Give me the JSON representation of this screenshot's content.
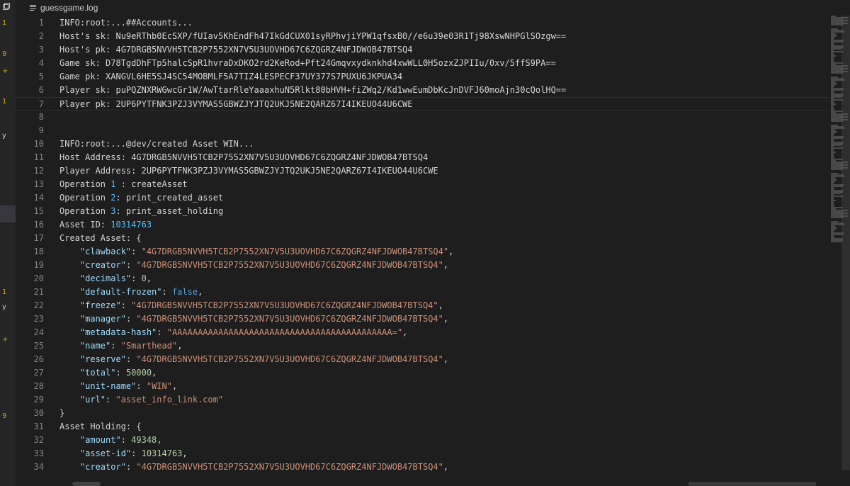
{
  "tab": {
    "filename": "guessgame.log"
  },
  "left_panel": {
    "marks": [
      {
        "text": "1"
      },
      {
        "text": "9"
      },
      {
        "text": "+"
      },
      {
        "text": "1"
      },
      {
        "text": "y"
      },
      {
        "text": "1"
      },
      {
        "text": "y"
      },
      {
        "text": "+"
      },
      {
        "text": "9"
      }
    ]
  },
  "lines": [
    {
      "num": "1",
      "text": "INFO:root:...##Accounts..."
    },
    {
      "num": "2",
      "text": "Host's sk: Nu9eRThb0EcSXP/fUIav5KhEndFh47IkGdCUX01syRPhvjiYPW1qfsxB0//e6u39e03R1Tj98XswNHPGlSOzgw=="
    },
    {
      "num": "3",
      "text": "Host's pk: 4G7DRGB5NVVH5TCB2P7552XN7V5U3UOVHD67C6ZQGRZ4NFJDWOB47BTSQ4"
    },
    {
      "num": "4",
      "text": "Game sk: D78TgdDhFTp5halcSpR1hvraDxDKO2rd2KeRod+Pft24Gmqvxydknkhd4xwWLL0H5ozxZJPIIu/0xv/5ffS9PA=="
    },
    {
      "num": "5",
      "text": "Game pk: XANGVL6HE5SJ4SC54MOBMLF5A7TIZ4LESPECF37UY377S7PUXU6JKPUA34"
    },
    {
      "num": "6",
      "text": "Player sk: puPQZNXRWGwcGr1W/AwTtarRleYaaaxhuN5Rlkt80bHVH+fiZWq2/Kd1wwEumDbKcJnDVFJ60moAjn30cQolHQ=="
    },
    {
      "num": "7",
      "text": "Player pk: 2UP6PYTFNK3PZJ3VYMAS5GBWZJYJTQ2UKJ5NE2QARZ67I4IKEUO44U6CWE"
    },
    {
      "num": "8",
      "text": ""
    },
    {
      "num": "9",
      "text": ""
    },
    {
      "num": "10",
      "text": "INFO:root:...@dev/created Asset WIN..."
    },
    {
      "num": "11",
      "text": "Host Address: 4G7DRGB5NVVH5TCB2P7552XN7V5U3UOVHD67C6ZQGRZ4NFJDWOB47BTSQ4"
    },
    {
      "num": "12",
      "text": "Player Address: 2UP6PYTFNK3PZJ3VYMAS5GBWZJYJTQ2UKJ5NE2QARZ67I4IKEUO44U6CWE"
    },
    {
      "num": "13",
      "pre": "Operation ",
      "num_val": "1",
      "post": " : createAsset"
    },
    {
      "num": "14",
      "pre": "Operation ",
      "num_val": "2",
      "post": ": print_created_asset"
    },
    {
      "num": "15",
      "pre": "Operation ",
      "num_val": "3",
      "post": ": print_asset_holding"
    },
    {
      "num": "16",
      "pre": "Asset ID: ",
      "num_val": "10314763",
      "post": ""
    },
    {
      "num": "17",
      "text": "Created Asset: {"
    },
    {
      "num": "18",
      "key": "\"clawback\"",
      "val": "\"4G7DRGB5NVVH5TCB2P7552XN7V5U3UOVHD67C6ZQGRZ4NFJDWOB47BTSQ4\"",
      "vtype": "s",
      "end": ","
    },
    {
      "num": "19",
      "key": "\"creator\"",
      "val": "\"4G7DRGB5NVVH5TCB2P7552XN7V5U3UOVHD67C6ZQGRZ4NFJDWOB47BTSQ4\"",
      "vtype": "s",
      "end": ","
    },
    {
      "num": "20",
      "key": "\"decimals\"",
      "val": "0",
      "vtype": "n",
      "end": ","
    },
    {
      "num": "21",
      "key": "\"default-frozen\"",
      "val": "false",
      "vtype": "b",
      "end": ","
    },
    {
      "num": "22",
      "key": "\"freeze\"",
      "val": "\"4G7DRGB5NVVH5TCB2P7552XN7V5U3UOVHD67C6ZQGRZ4NFJDWOB47BTSQ4\"",
      "vtype": "s",
      "end": ","
    },
    {
      "num": "23",
      "key": "\"manager\"",
      "val": "\"4G7DRGB5NVVH5TCB2P7552XN7V5U3UOVHD67C6ZQGRZ4NFJDWOB47BTSQ4\"",
      "vtype": "s",
      "end": ","
    },
    {
      "num": "24",
      "key": "\"metadata-hash\"",
      "val": "\"AAAAAAAAAAAAAAAAAAAAAAAAAAAAAAAAAAAAAAAAAAA=\"",
      "vtype": "s",
      "end": ","
    },
    {
      "num": "25",
      "key": "\"name\"",
      "val": "\"Smarthead\"",
      "vtype": "s",
      "end": ","
    },
    {
      "num": "26",
      "key": "\"reserve\"",
      "val": "\"4G7DRGB5NVVH5TCB2P7552XN7V5U3UOVHD67C6ZQGRZ4NFJDWOB47BTSQ4\"",
      "vtype": "s",
      "end": ","
    },
    {
      "num": "27",
      "key": "\"total\"",
      "val": "50000",
      "vtype": "n",
      "end": ","
    },
    {
      "num": "28",
      "key": "\"unit-name\"",
      "val": "\"WIN\"",
      "vtype": "s",
      "end": ","
    },
    {
      "num": "29",
      "key": "\"url\"",
      "val": "\"asset_info_link.com\"",
      "vtype": "s",
      "end": ""
    },
    {
      "num": "30",
      "text": "}"
    },
    {
      "num": "31",
      "text": "Asset Holding: {"
    },
    {
      "num": "32",
      "key": "\"amount\"",
      "val": "49348",
      "vtype": "n",
      "end": ","
    },
    {
      "num": "33",
      "key": "\"asset-id\"",
      "val": "10314763",
      "vtype": "n",
      "end": ","
    },
    {
      "num": "34",
      "key": "\"creator\"",
      "val": "\"4G7DRGB5NVVH5TCB2P7552XN7V5U3UOVHD67C6ZQGRZ4NFJDWOB47BTSQ4\"",
      "vtype": "s",
      "end": ","
    }
  ],
  "colors": {
    "background": "#1e1e1e",
    "line_number": "#858585",
    "json_key": "#9cdcfe",
    "string": "#ce9178",
    "number": "#b5cea8",
    "boolean": "#569cd6",
    "warning_mark": "#cca700"
  },
  "icons": [
    "copy-icon",
    "file-lines-icon"
  ]
}
